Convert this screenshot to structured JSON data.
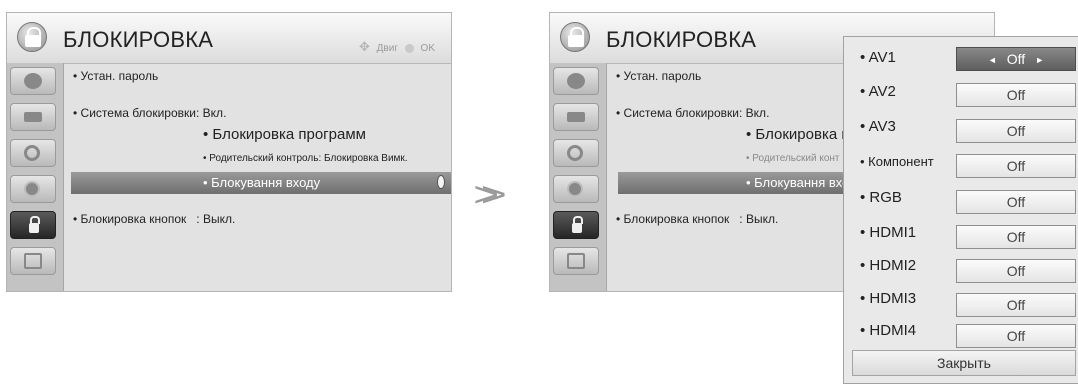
{
  "left": {
    "title": "БЛОКИРОВКА",
    "hints": {
      "move": "Двиг",
      "ok": "OK"
    },
    "items": {
      "set_password": "• Устан. пароль",
      "lock_system": "• Система блокировки",
      "lock_system_sep": ":",
      "lock_system_value": "Вкл.",
      "block_programs": "• Блокировка программ",
      "parental": "• Родительский контроль: Блокировка Вимк.",
      "input_block": "• Блокування входу",
      "key_lock": "• Блокировка кнопок",
      "key_lock_value": ": Выкл."
    }
  },
  "right": {
    "title": "БЛОКИРОВКА",
    "items": {
      "set_password": "• Устан. пароль",
      "lock_system": "• Система блокировки",
      "lock_system_sep": ":",
      "lock_system_value": "Вкл.",
      "block_programs": "• Блокировка п",
      "parental": "• Родительский конт",
      "input_block": "• Блокування вхо",
      "key_lock": "• Блокировка кнопок",
      "key_lock_value": ": Выкл."
    }
  },
  "sidebar_icons": [
    "picture-icon",
    "screen-icon",
    "audio-icon",
    "clock-icon",
    "lock-icon",
    "option-icon"
  ],
  "popup": {
    "rows": [
      {
        "label": "• AV1",
        "value": "Off",
        "active": true
      },
      {
        "label": "• AV2",
        "value": "Off"
      },
      {
        "label": "• AV3",
        "value": "Off"
      },
      {
        "label": "• Компонент",
        "value": "Off"
      },
      {
        "label": "• RGB",
        "value": "Off"
      },
      {
        "label": "• HDMI1",
        "value": "Off"
      },
      {
        "label": "• HDMI2",
        "value": "Off"
      },
      {
        "label": "• HDMI3",
        "value": "Off"
      },
      {
        "label": "• HDMI4",
        "value": "Off"
      }
    ],
    "arrow_left": "◄",
    "arrow_right": "►",
    "close": "Закрыть"
  },
  "transition_arrow": ">"
}
